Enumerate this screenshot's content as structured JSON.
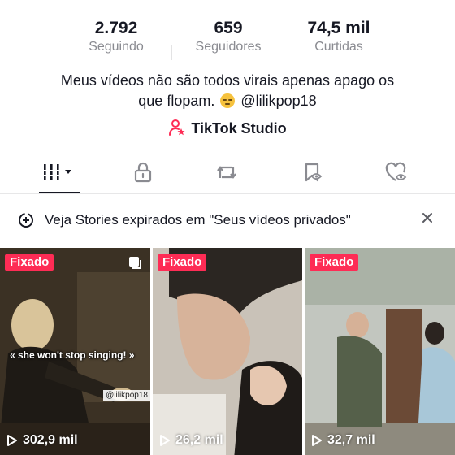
{
  "stats": {
    "following": {
      "value": "2.792",
      "label": "Seguindo"
    },
    "followers": {
      "value": "659",
      "label": "Seguidores"
    },
    "likes": {
      "value": "74,5 mil",
      "label": "Curtidas"
    }
  },
  "bio": {
    "line1": "Meus vídeos não são todos virais apenas apago os",
    "line2_start": "que flopam.",
    "line2_end": "@lilikpop18"
  },
  "studio": {
    "label": "TikTok Studio"
  },
  "tabs": [
    {
      "icon": "grid-icon",
      "active": true
    },
    {
      "icon": "lock-icon",
      "active": false
    },
    {
      "icon": "repost-icon",
      "active": false
    },
    {
      "icon": "bookmark-hidden-icon",
      "active": false
    },
    {
      "icon": "heart-hidden-icon",
      "active": false
    }
  ],
  "notice": {
    "text": "Veja Stories expirados em \"Seus vídeos privados\""
  },
  "videos": [
    {
      "badge": "Fixado",
      "views": "302,9 mil",
      "caption": "« she won't stop singing! »",
      "handle": "@lilikpop18"
    },
    {
      "badge": "Fixado",
      "views": "26,2 mil"
    },
    {
      "badge": "Fixado",
      "views": "32,7 mil"
    }
  ],
  "colors": {
    "accent": "#fe2c55",
    "text": "#161823",
    "muted": "#8a8b91"
  }
}
